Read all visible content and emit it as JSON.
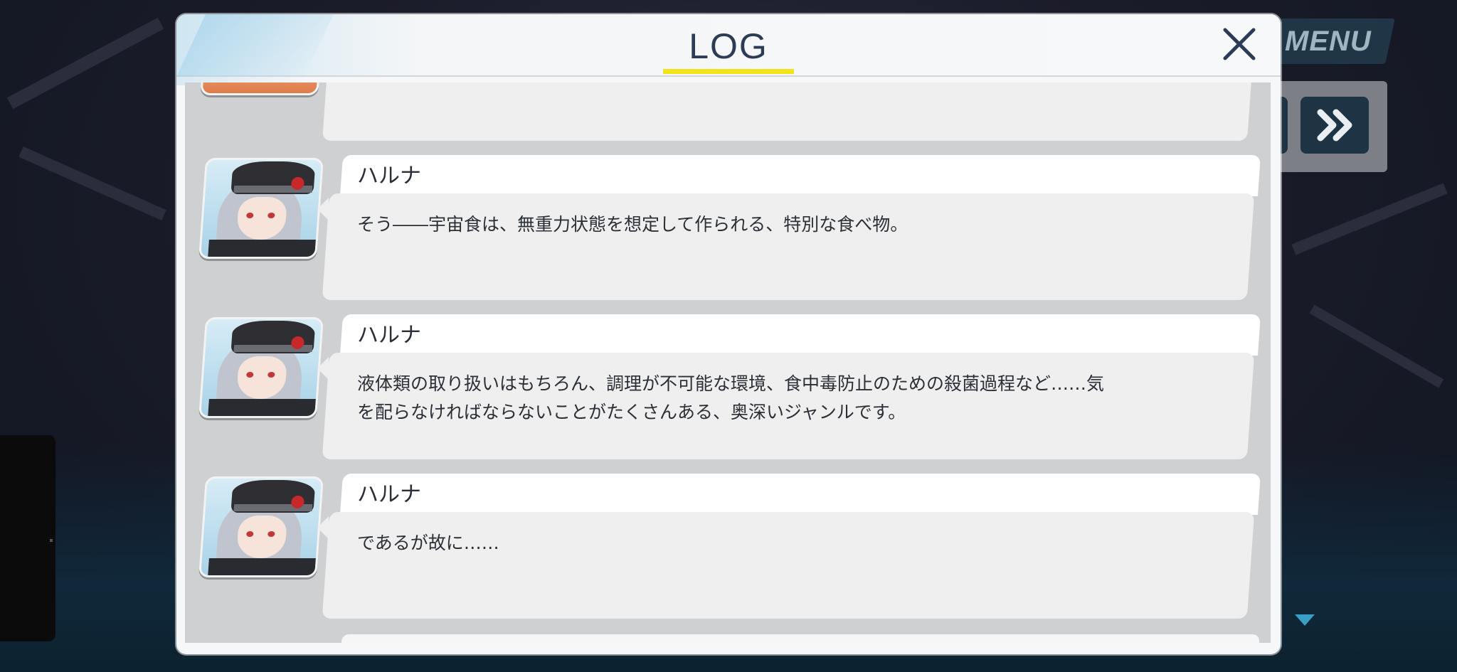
{
  "window": {
    "title": "LOG",
    "close_icon": "close-icon"
  },
  "hud": {
    "menu_label": "MENU",
    "skip_icon": "fast-forward-icon"
  },
  "colors": {
    "title_underline": "#f2e31c",
    "title_text": "#2c3c56",
    "panel_bg": "#cfd0d1"
  },
  "log_entries": [
    {
      "speaker": "ハルナ",
      "lines": [
        "そう――宇宙食は、無重力状態を想定して作られる、特別な食べ物。"
      ]
    },
    {
      "speaker": "ハルナ",
      "lines": [
        "液体類の取り扱いはもちろん、調理が不可能な環境、食中毒防止のための殺菌過程など……気",
        "を配らなければならないことがたくさんある、奥深いジャンルです。"
      ]
    },
    {
      "speaker": "ハルナ",
      "lines": [
        "であるが故に……"
      ]
    }
  ]
}
